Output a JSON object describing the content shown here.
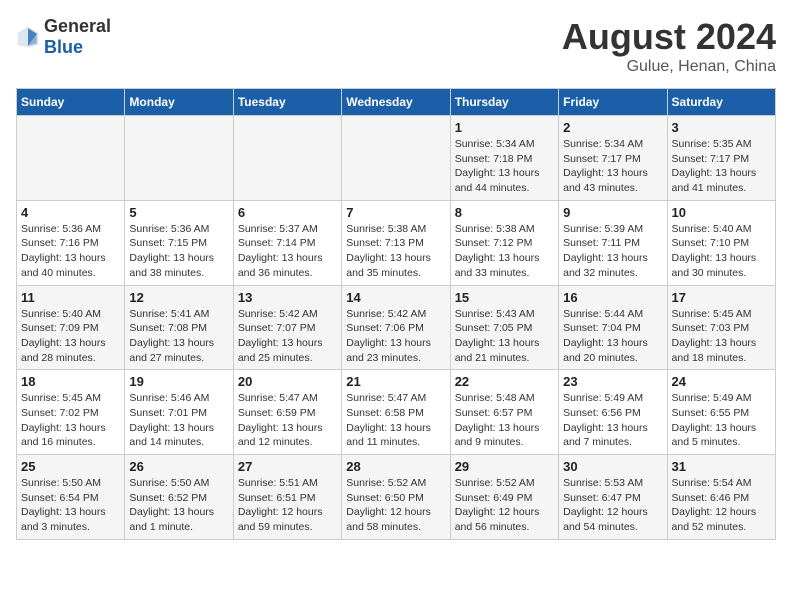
{
  "header": {
    "logo_general": "General",
    "logo_blue": "Blue",
    "title": "August 2024",
    "location": "Gulue, Henan, China"
  },
  "weekdays": [
    "Sunday",
    "Monday",
    "Tuesday",
    "Wednesday",
    "Thursday",
    "Friday",
    "Saturday"
  ],
  "weeks": [
    [
      {
        "day": "",
        "info": ""
      },
      {
        "day": "",
        "info": ""
      },
      {
        "day": "",
        "info": ""
      },
      {
        "day": "",
        "info": ""
      },
      {
        "day": "1",
        "info": "Sunrise: 5:34 AM\nSunset: 7:18 PM\nDaylight: 13 hours\nand 44 minutes."
      },
      {
        "day": "2",
        "info": "Sunrise: 5:34 AM\nSunset: 7:17 PM\nDaylight: 13 hours\nand 43 minutes."
      },
      {
        "day": "3",
        "info": "Sunrise: 5:35 AM\nSunset: 7:17 PM\nDaylight: 13 hours\nand 41 minutes."
      }
    ],
    [
      {
        "day": "4",
        "info": "Sunrise: 5:36 AM\nSunset: 7:16 PM\nDaylight: 13 hours\nand 40 minutes."
      },
      {
        "day": "5",
        "info": "Sunrise: 5:36 AM\nSunset: 7:15 PM\nDaylight: 13 hours\nand 38 minutes."
      },
      {
        "day": "6",
        "info": "Sunrise: 5:37 AM\nSunset: 7:14 PM\nDaylight: 13 hours\nand 36 minutes."
      },
      {
        "day": "7",
        "info": "Sunrise: 5:38 AM\nSunset: 7:13 PM\nDaylight: 13 hours\nand 35 minutes."
      },
      {
        "day": "8",
        "info": "Sunrise: 5:38 AM\nSunset: 7:12 PM\nDaylight: 13 hours\nand 33 minutes."
      },
      {
        "day": "9",
        "info": "Sunrise: 5:39 AM\nSunset: 7:11 PM\nDaylight: 13 hours\nand 32 minutes."
      },
      {
        "day": "10",
        "info": "Sunrise: 5:40 AM\nSunset: 7:10 PM\nDaylight: 13 hours\nand 30 minutes."
      }
    ],
    [
      {
        "day": "11",
        "info": "Sunrise: 5:40 AM\nSunset: 7:09 PM\nDaylight: 13 hours\nand 28 minutes."
      },
      {
        "day": "12",
        "info": "Sunrise: 5:41 AM\nSunset: 7:08 PM\nDaylight: 13 hours\nand 27 minutes."
      },
      {
        "day": "13",
        "info": "Sunrise: 5:42 AM\nSunset: 7:07 PM\nDaylight: 13 hours\nand 25 minutes."
      },
      {
        "day": "14",
        "info": "Sunrise: 5:42 AM\nSunset: 7:06 PM\nDaylight: 13 hours\nand 23 minutes."
      },
      {
        "day": "15",
        "info": "Sunrise: 5:43 AM\nSunset: 7:05 PM\nDaylight: 13 hours\nand 21 minutes."
      },
      {
        "day": "16",
        "info": "Sunrise: 5:44 AM\nSunset: 7:04 PM\nDaylight: 13 hours\nand 20 minutes."
      },
      {
        "day": "17",
        "info": "Sunrise: 5:45 AM\nSunset: 7:03 PM\nDaylight: 13 hours\nand 18 minutes."
      }
    ],
    [
      {
        "day": "18",
        "info": "Sunrise: 5:45 AM\nSunset: 7:02 PM\nDaylight: 13 hours\nand 16 minutes."
      },
      {
        "day": "19",
        "info": "Sunrise: 5:46 AM\nSunset: 7:01 PM\nDaylight: 13 hours\nand 14 minutes."
      },
      {
        "day": "20",
        "info": "Sunrise: 5:47 AM\nSunset: 6:59 PM\nDaylight: 13 hours\nand 12 minutes."
      },
      {
        "day": "21",
        "info": "Sunrise: 5:47 AM\nSunset: 6:58 PM\nDaylight: 13 hours\nand 11 minutes."
      },
      {
        "day": "22",
        "info": "Sunrise: 5:48 AM\nSunset: 6:57 PM\nDaylight: 13 hours\nand 9 minutes."
      },
      {
        "day": "23",
        "info": "Sunrise: 5:49 AM\nSunset: 6:56 PM\nDaylight: 13 hours\nand 7 minutes."
      },
      {
        "day": "24",
        "info": "Sunrise: 5:49 AM\nSunset: 6:55 PM\nDaylight: 13 hours\nand 5 minutes."
      }
    ],
    [
      {
        "day": "25",
        "info": "Sunrise: 5:50 AM\nSunset: 6:54 PM\nDaylight: 13 hours\nand 3 minutes."
      },
      {
        "day": "26",
        "info": "Sunrise: 5:50 AM\nSunset: 6:52 PM\nDaylight: 13 hours\nand 1 minute."
      },
      {
        "day": "27",
        "info": "Sunrise: 5:51 AM\nSunset: 6:51 PM\nDaylight: 12 hours\nand 59 minutes."
      },
      {
        "day": "28",
        "info": "Sunrise: 5:52 AM\nSunset: 6:50 PM\nDaylight: 12 hours\nand 58 minutes."
      },
      {
        "day": "29",
        "info": "Sunrise: 5:52 AM\nSunset: 6:49 PM\nDaylight: 12 hours\nand 56 minutes."
      },
      {
        "day": "30",
        "info": "Sunrise: 5:53 AM\nSunset: 6:47 PM\nDaylight: 12 hours\nand 54 minutes."
      },
      {
        "day": "31",
        "info": "Sunrise: 5:54 AM\nSunset: 6:46 PM\nDaylight: 12 hours\nand 52 minutes."
      }
    ]
  ]
}
